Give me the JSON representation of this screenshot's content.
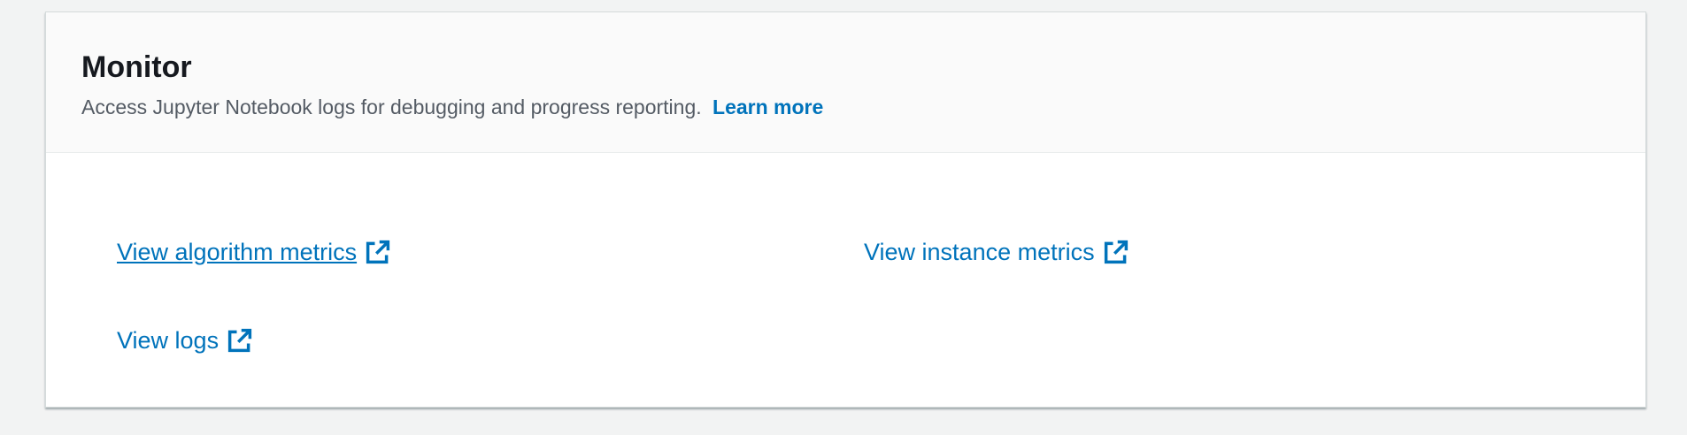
{
  "monitor": {
    "title": "Monitor",
    "description": "Access Jupyter Notebook logs for debugging and progress reporting.",
    "learn_more": "Learn more"
  },
  "links": {
    "algorithm_metrics": "View algorithm metrics",
    "instance_metrics": "View instance metrics",
    "logs": "View logs"
  },
  "icons": {
    "external": "external-link-icon"
  },
  "colors": {
    "link": "#0073bb",
    "title": "#16191f",
    "description": "#545b64"
  }
}
